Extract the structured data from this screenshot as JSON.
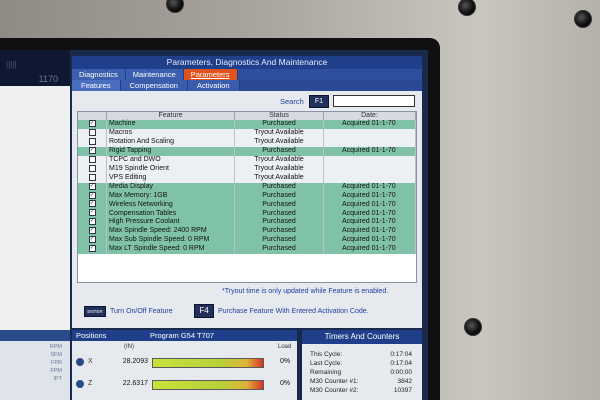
{
  "window_title": "Parameters, Diagnostics And Maintenance",
  "tabs": [
    {
      "label": "Diagnostics",
      "active": false
    },
    {
      "label": "Maintenance",
      "active": false
    },
    {
      "label": "Parameters",
      "active": true
    }
  ],
  "subtabs": [
    {
      "label": "Features",
      "active": true
    },
    {
      "label": "Compensation",
      "active": false
    },
    {
      "label": "Activation",
      "active": false
    }
  ],
  "search": {
    "label": "Search",
    "key": "F1",
    "value": ""
  },
  "table": {
    "columns": [
      "Feature",
      "Status",
      "Date:"
    ],
    "rows": [
      {
        "checked": true,
        "feature": "Machine",
        "status": "Purchased",
        "date": "Acquired 01-1-70"
      },
      {
        "checked": false,
        "feature": "Macros",
        "status": "Tryout Available",
        "date": ""
      },
      {
        "checked": false,
        "feature": "Rotation And Scaling",
        "status": "Tryout Available",
        "date": ""
      },
      {
        "checked": true,
        "feature": "Rigid Tapping",
        "status": "Purchased",
        "date": "Acquired 01-1-70"
      },
      {
        "checked": false,
        "feature": "TCPC and DWO",
        "status": "Tryout Available",
        "date": ""
      },
      {
        "checked": false,
        "feature": "M19 Spindle Orient",
        "status": "Tryout Available",
        "date": ""
      },
      {
        "checked": false,
        "feature": "VPS Editing",
        "status": "Tryout Available",
        "date": ""
      },
      {
        "checked": true,
        "feature": "Media Display",
        "status": "Purchased",
        "date": "Acquired 01-1-70"
      },
      {
        "checked": true,
        "feature": "Max Memory: 1GB",
        "status": "Purchased",
        "date": "Acquired 01-1-70"
      },
      {
        "checked": true,
        "feature": "Wireless Networking",
        "status": "Purchased",
        "date": "Acquired 01-1-70"
      },
      {
        "checked": true,
        "feature": "Compensation Tables",
        "status": "Purchased",
        "date": "Acquired 01-1-70"
      },
      {
        "checked": true,
        "feature": "High Pressure Coolant",
        "status": "Purchased",
        "date": "Acquired 01-1-70"
      },
      {
        "checked": true,
        "feature": "Max Spindle Speed: 2400 RPM",
        "status": "Purchased",
        "date": "Acquired 01-1-70"
      },
      {
        "checked": true,
        "feature": "Max Sub Spindle Speed: 0 RPM",
        "status": "Purchased",
        "date": "Acquired 01-1-70"
      },
      {
        "checked": true,
        "feature": "Max LT Spindle Speed: 0 RPM",
        "status": "Purchased",
        "date": "Acquired 01-1-70"
      }
    ]
  },
  "tryout_note": "*Tryout time is only updated while Feature is enabled.",
  "hints": {
    "enter_key": "ENTER",
    "enter_text": "Turn On/Off Feature",
    "f4_key": "F4",
    "f4_text": "Purchase Feature With Entered Activation Code."
  },
  "left_panel": {
    "header": "1170",
    "labels": [
      "RPM",
      "SFM",
      "FPR",
      "FPM",
      "IPT"
    ]
  },
  "positions": {
    "title": "Positions",
    "program": "Program G54 T707",
    "unit": "(IN)",
    "load_label": "Load",
    "axes": [
      {
        "name": "X",
        "value": "28.2093",
        "load": "0%"
      },
      {
        "name": "Z",
        "value": "22.6317",
        "load": "0%"
      }
    ]
  },
  "timers": {
    "title": "Timers And Counters",
    "rows": [
      {
        "label": "This Cycle:",
        "value": "0:17:04"
      },
      {
        "label": "Last Cycle:",
        "value": "0:17:04"
      },
      {
        "label": "Remaining",
        "value": "0:00:00"
      },
      {
        "label": "M30 Counter #1:",
        "value": "3842"
      },
      {
        "label": "M30 Counter #2:",
        "value": "10397"
      }
    ]
  },
  "colors": {
    "title_bar": "#1f3f8a",
    "active_tab": "#e0531d",
    "purchased_row": "#7fc2a8"
  }
}
